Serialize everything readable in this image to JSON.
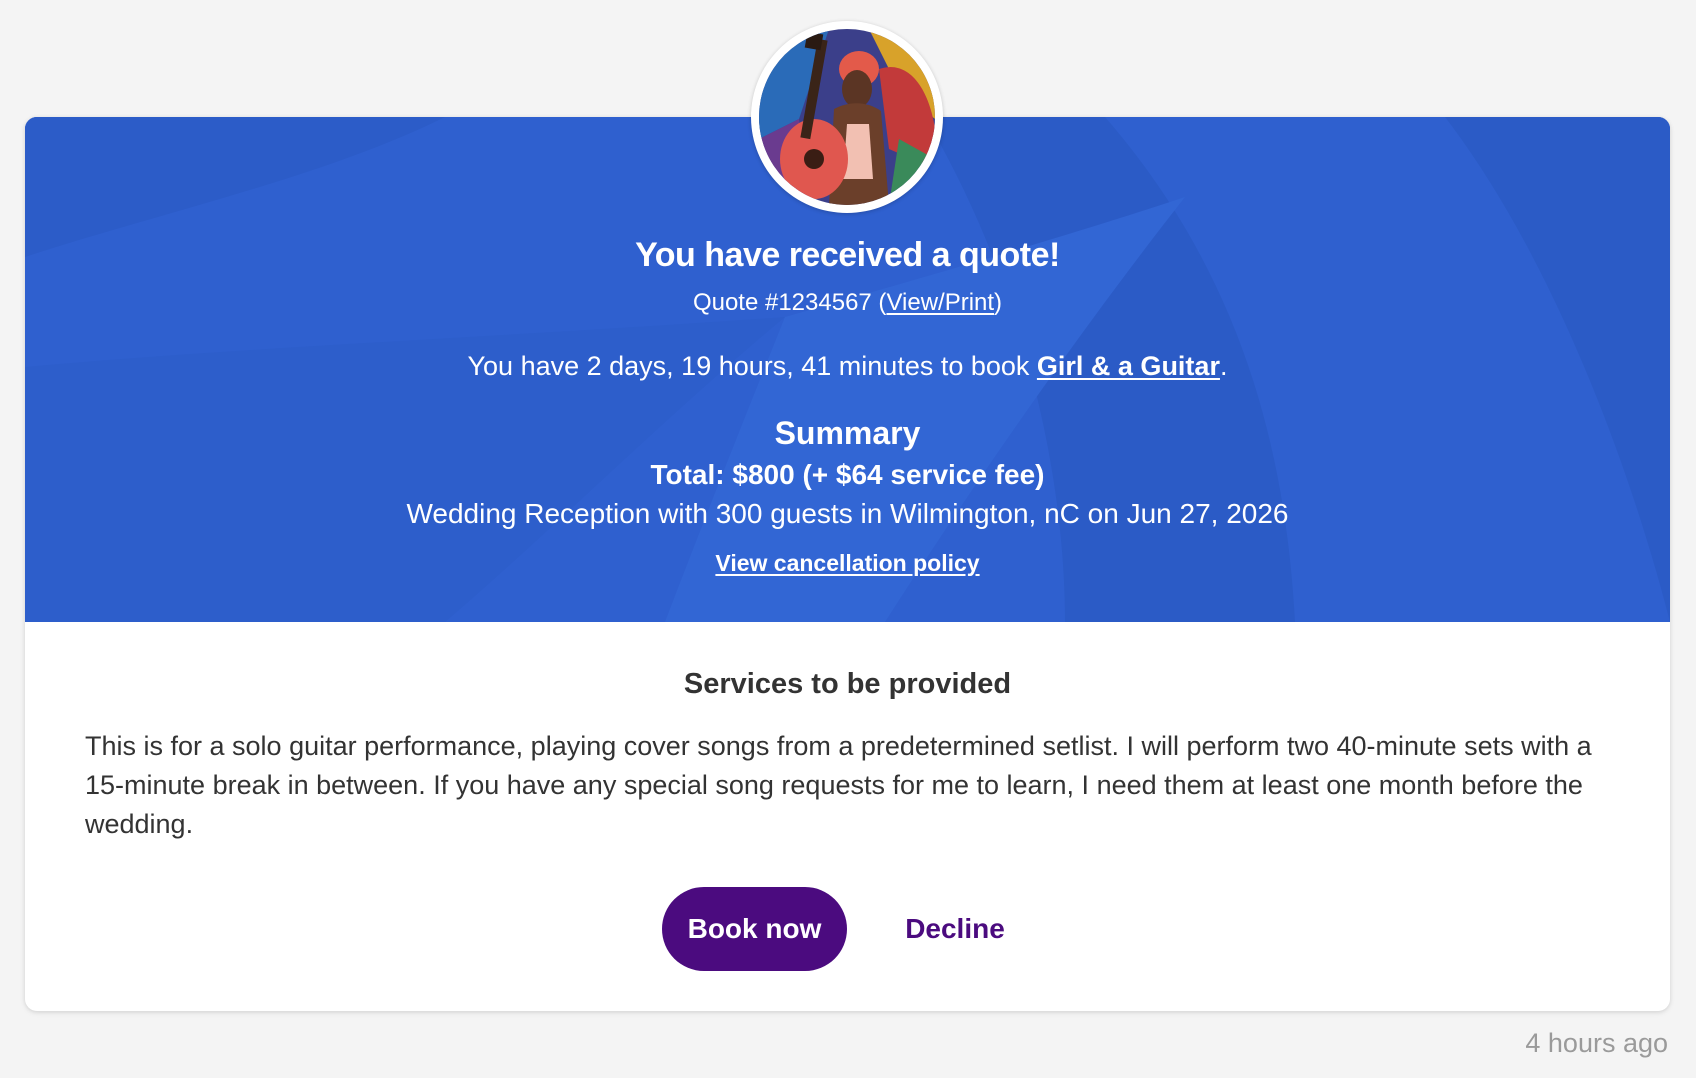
{
  "quote": {
    "title": "You have received a quote!",
    "number_text": "Quote #1234567",
    "open_paren": " (",
    "view_print_label": "View/Print",
    "close_paren": ")"
  },
  "booking": {
    "prefix": "You have 2 days, 19 hours, 41 minutes to book ",
    "artist_name": "Girl & a Guitar",
    "suffix": "."
  },
  "summary": {
    "title": "Summary",
    "total": "Total: $800 (+ $64 service fee)",
    "event": "Wedding Reception with 300 guests in Wilmington, nC on Jun 27, 2026",
    "cancellation_link": "View cancellation policy"
  },
  "services": {
    "title": "Services to be provided",
    "description": "This is for a solo guitar performance, playing cover songs from a predetermined setlist. I will perform two 40-minute sets with a 15-minute break in between. If you have any special song requests for me to learn, I need them at least one month before the wedding."
  },
  "actions": {
    "book_label": "Book now",
    "decline_label": "Decline"
  },
  "timestamp": "4 hours ago",
  "colors": {
    "hero_blue": "#2f60cf",
    "primary_purple": "#4b0b7f",
    "page_background": "#f4f4f4"
  },
  "avatar": {
    "icon": "performer-photo"
  }
}
